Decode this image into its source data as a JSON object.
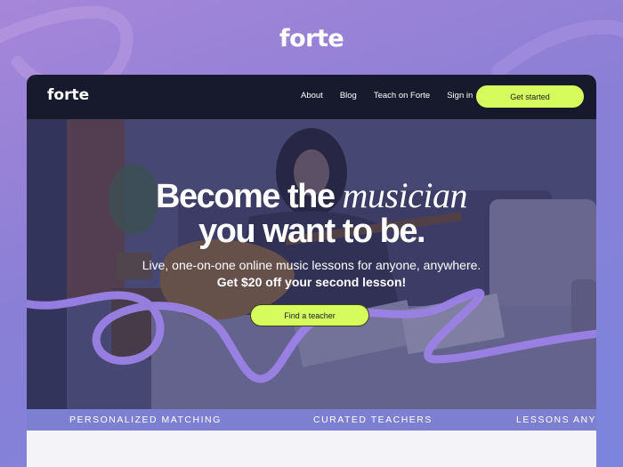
{
  "brand": {
    "logo_text": "forte",
    "accent": "#d6fb5c",
    "nav_bg": "#171a2c",
    "ticker_bg": "#7d7fd1"
  },
  "nav": {
    "logo": "forte",
    "links": [
      "About",
      "Blog",
      "Teach on Forte",
      "Sign in"
    ],
    "cta": "Get started"
  },
  "hero": {
    "headline_part1": "Become the",
    "headline_italic": "musician",
    "headline_line2": "you want to be.",
    "subtitle": "Live, one-on-one online music lessons for anyone, anywhere.",
    "promo": "Get $20 off your second lesson!",
    "cta": "Find a teacher"
  },
  "ticker": {
    "items": [
      "PERSONALIZED MATCHING",
      "CURATED TEACHERS",
      "LESSONS ANYTI"
    ]
  }
}
